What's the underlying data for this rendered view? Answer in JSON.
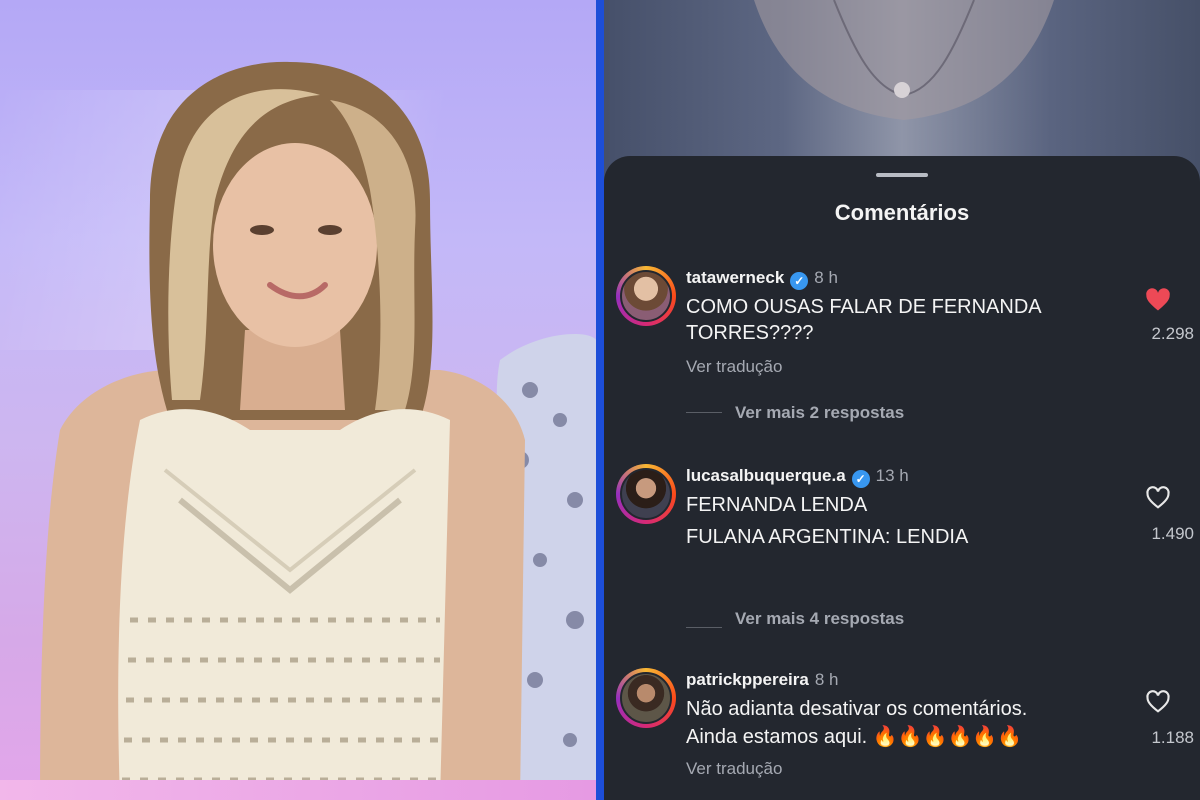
{
  "sheet": {
    "title": "Comentários"
  },
  "comments": [
    {
      "username": "tatawerneck",
      "verified": true,
      "time": "8 h",
      "lines": [
        "COMO OUSAS FALAR DE FERNANDA",
        "TORRES????"
      ],
      "translate_label": "Ver tradução",
      "replies_label": "Ver mais 2 respostas",
      "likes": "2.298",
      "liked": true
    },
    {
      "username": "lucasalbuquerque.a",
      "verified": true,
      "time": "13 h",
      "lines": [
        "FERNANDA LENDA",
        "FULANA ARGENTINA: LENDIA"
      ],
      "replies_label": "Ver mais 4 respostas",
      "likes": "1.490",
      "liked": false
    },
    {
      "username": "patrickppereira",
      "verified": false,
      "time": "8 h",
      "lines": [
        "Não adianta desativar os comentários.",
        "Ainda estamos aqui. 🔥🔥🔥🔥🔥🔥"
      ],
      "translate_label": "Ver tradução",
      "likes": "1.188",
      "liked": false
    }
  ],
  "colors": {
    "divider": "#1d4ed8",
    "sheet_bg": "#23272f",
    "heart_red": "#ed4956",
    "verified_blue": "#3897f0"
  },
  "icons": {
    "heart": "heart-icon",
    "verified": "verified-badge-icon"
  }
}
